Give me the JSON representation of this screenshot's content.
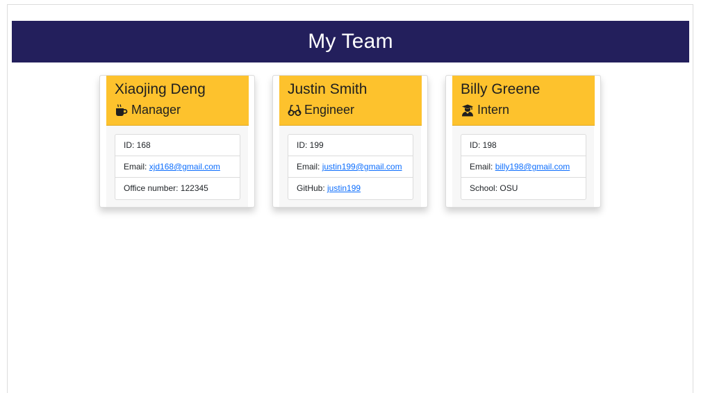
{
  "header": {
    "title": "My Team"
  },
  "colors": {
    "header_bg": "#231f5c",
    "card_header_bg": "#fdc22d",
    "link": "#0d6efd"
  },
  "team": [
    {
      "name": "Xiaojing Deng",
      "role": "Manager",
      "role_icon": "coffee-mug-icon",
      "id_label": "ID: 168",
      "email_prefix": "Email: ",
      "email": "xjd168@gmail.com",
      "extra_prefix": "Office number: 122345",
      "extra_link": ""
    },
    {
      "name": "Justin Smith",
      "role": "Engineer",
      "role_icon": "glasses-icon",
      "id_label": "ID: 199",
      "email_prefix": "Email: ",
      "email": "justin199@gmail.com",
      "extra_prefix": "GitHub: ",
      "extra_link": "justin199"
    },
    {
      "name": "Billy Greene",
      "role": "Intern",
      "role_icon": "graduate-icon",
      "id_label": "ID: 198",
      "email_prefix": "Email: ",
      "email": "billy198@gmail.com",
      "extra_prefix": "School: OSU",
      "extra_link": ""
    }
  ]
}
